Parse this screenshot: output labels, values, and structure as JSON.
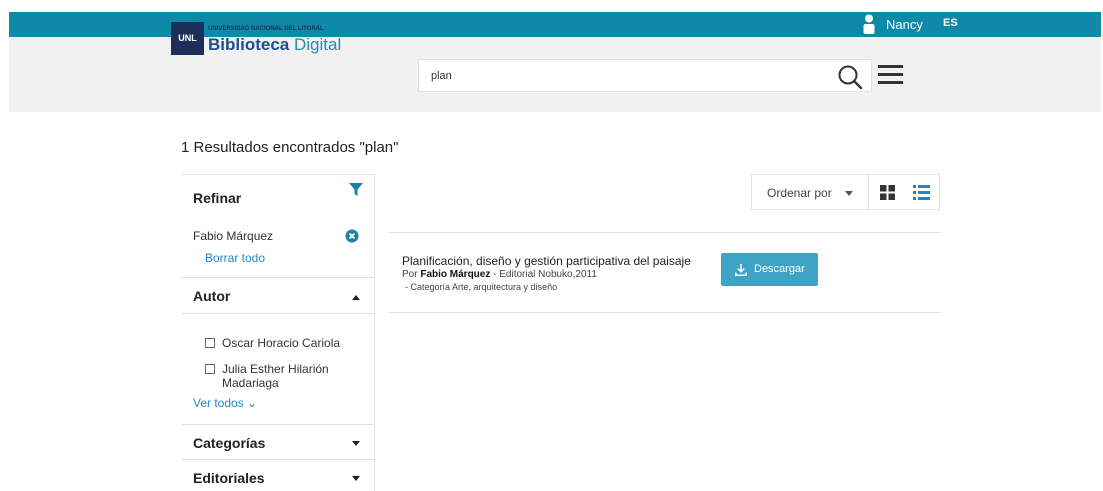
{
  "topbar": {
    "user_icon": "user-icon",
    "user_name": "Nancy",
    "language": "ES",
    "background_color": "#0e8aa8"
  },
  "logo": {
    "badge": "UNL",
    "subtitle": "UNIVERSIDAD NACIONAL DEL LITORAL",
    "title_bold": "Biblioteca",
    "title_light": "Digital"
  },
  "search": {
    "value": "plan",
    "icon": "search-icon"
  },
  "menu_icon": "hamburger-menu-icon",
  "results": {
    "title": "1 Resultados encontrados \"plan\""
  },
  "sidebar": {
    "refine_label": "Refinar",
    "filter_icon": "filter-icon",
    "active_filter": "Fabio Márquez",
    "clear_all": "Borrar todo",
    "sections": [
      {
        "title": "Autor",
        "expanded": true
      },
      {
        "title": "Categorías",
        "expanded": false
      },
      {
        "title": "Editoriales",
        "expanded": false
      }
    ],
    "author_options": [
      "Oscar Horacio Cariola",
      "Julia Esther Hilarión",
      "Madariaga"
    ],
    "see_all": "Ver todos ⌄"
  },
  "toolbar": {
    "sort_label": "Ordenar por",
    "grid_icon": "grid-view-icon",
    "list_icon": "list-view-icon",
    "accent_color": "#1e88c5"
  },
  "result_item": {
    "title": "Planificación, diseño y gestión participativa del paisaje",
    "by_prefix": "Por",
    "author": "Fabio Márquez",
    "publisher": "- Editorial Nobuko,2011",
    "category": "- Categoría Arte, arquitectura y diseño",
    "download_label": "Descargar",
    "download_color": "#3fa3c6"
  }
}
